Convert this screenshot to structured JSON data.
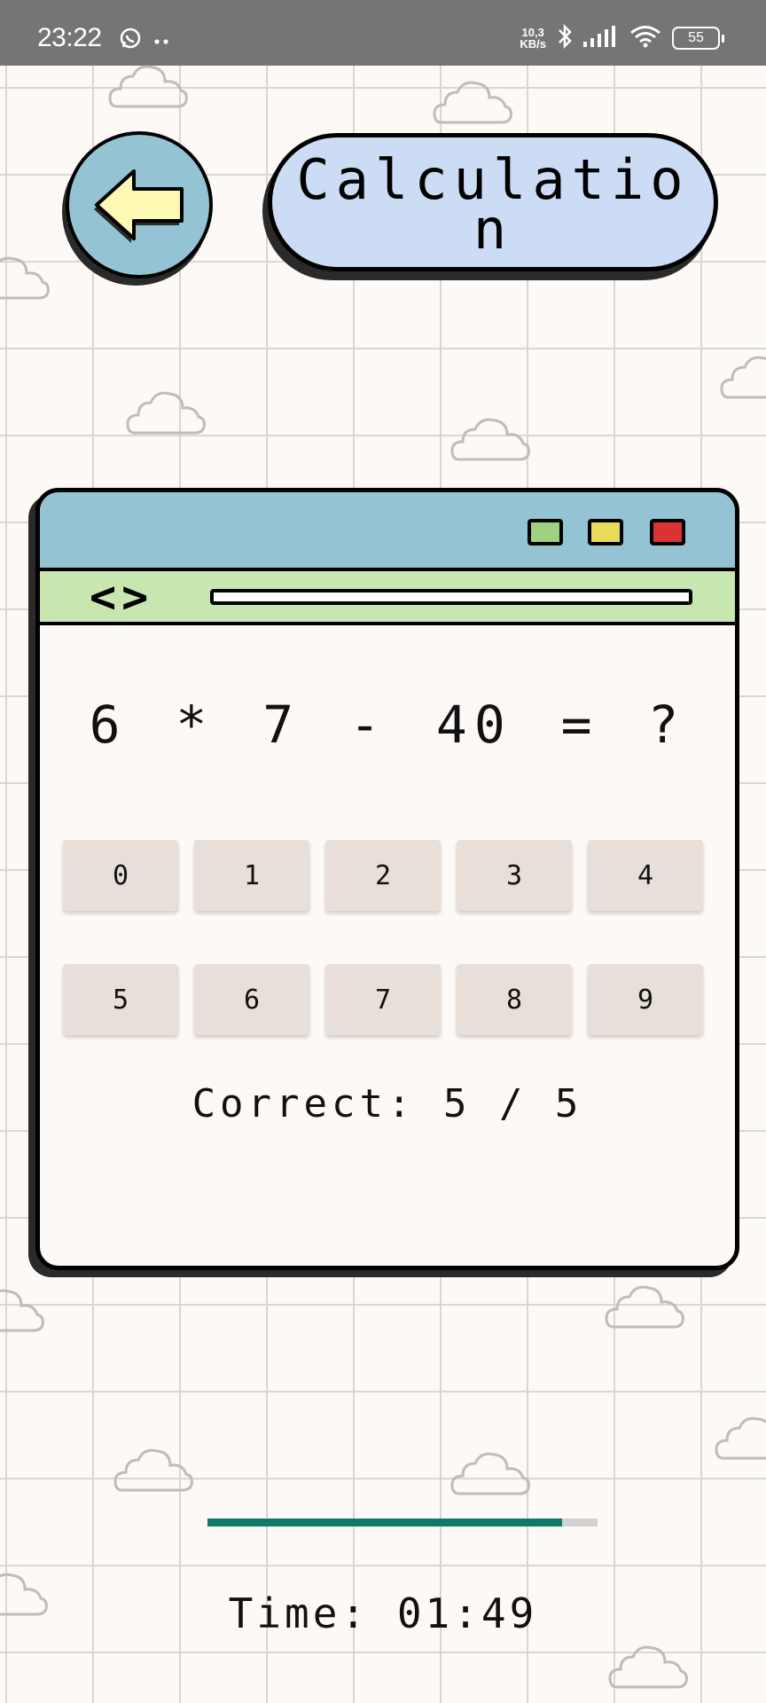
{
  "status_bar": {
    "time": "23:22",
    "network_speed_value": "10,3",
    "network_speed_unit": "KB/s",
    "battery": "55",
    "icons": [
      "whatsapp-icon",
      "notification-dots-icon",
      "bluetooth-icon",
      "signal-icon",
      "wifi-icon",
      "battery-icon"
    ]
  },
  "header": {
    "back_icon": "arrow-left-icon",
    "title": "Calculation"
  },
  "window": {
    "nav_arrows": "<>",
    "window_buttons": [
      {
        "name": "green",
        "color": "#9ed27e"
      },
      {
        "name": "yellow",
        "color": "#e8db5a"
      },
      {
        "name": "red",
        "color": "#db3233"
      }
    ]
  },
  "quiz": {
    "question": "6 * 7 - 40 = ?",
    "answers": [
      "0",
      "1",
      "2",
      "3",
      "4",
      "5",
      "6",
      "7",
      "8",
      "9"
    ],
    "correct_label": "Correct: 5 / 5"
  },
  "progress": {
    "fraction": 0.91,
    "fill_color": "#0f7a6c",
    "track_color": "#d2d2d2"
  },
  "timer": {
    "label": "Time: 01:49"
  },
  "colors": {
    "background": "#fdf9f6",
    "grid": "#d9d6d4",
    "titlebar": "#94c4d3",
    "navbar": "#c8e6b0",
    "title_pill": "#ccdcf5",
    "back_arrow": "#fdf8b4",
    "answer_button": "#e7dfd8"
  }
}
